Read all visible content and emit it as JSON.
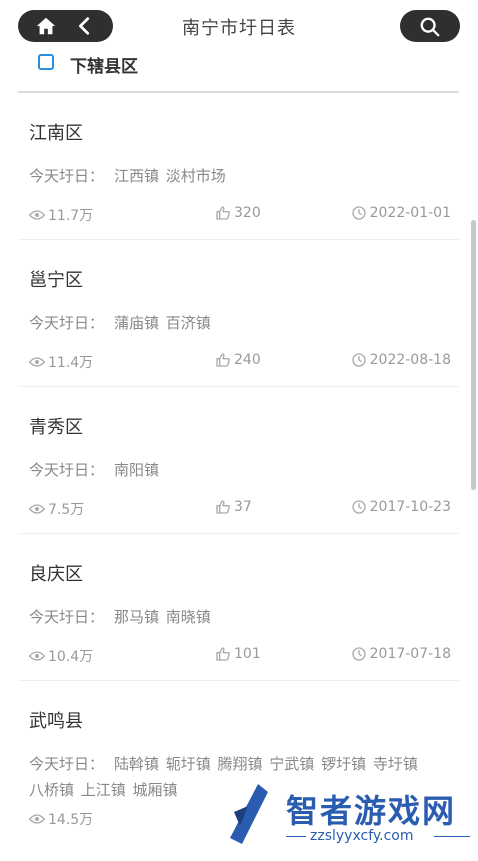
{
  "header": {
    "title": "南宁市圩日表",
    "home_icon": "home-icon",
    "back_icon": "chevron-left-icon",
    "search_icon": "search-icon"
  },
  "subheader": {
    "label": "下辖县区"
  },
  "market_label": "今天圩日：",
  "districts": [
    {
      "name": "江南区",
      "towns": "江西镇 淡村市场",
      "views": "11.7万",
      "likes": "320",
      "date": "2022-01-01"
    },
    {
      "name": "邕宁区",
      "towns": "蒲庙镇 百济镇",
      "views": "11.4万",
      "likes": "240",
      "date": "2022-08-18"
    },
    {
      "name": "青秀区",
      "towns": "南阳镇",
      "views": "7.5万",
      "likes": "37",
      "date": "2017-10-23"
    },
    {
      "name": "良庆区",
      "towns": "那马镇 南晓镇",
      "views": "10.4万",
      "likes": "101",
      "date": "2017-07-18"
    },
    {
      "name": "武鸣县",
      "towns": "陆斡镇 轭圩镇 腾翔镇 宁武镇 锣圩镇 寺圩镇 八桥镇 上江镇 城厢镇",
      "views": "14.5万",
      "likes": "",
      "date": ""
    }
  ],
  "watermark": {
    "name": "智者游戏网",
    "url": "zzslyyxcfy.com"
  },
  "colors": {
    "accent": "#2a8ee0",
    "pill": "#2f2f2f",
    "watermark": "#2a5db0"
  }
}
